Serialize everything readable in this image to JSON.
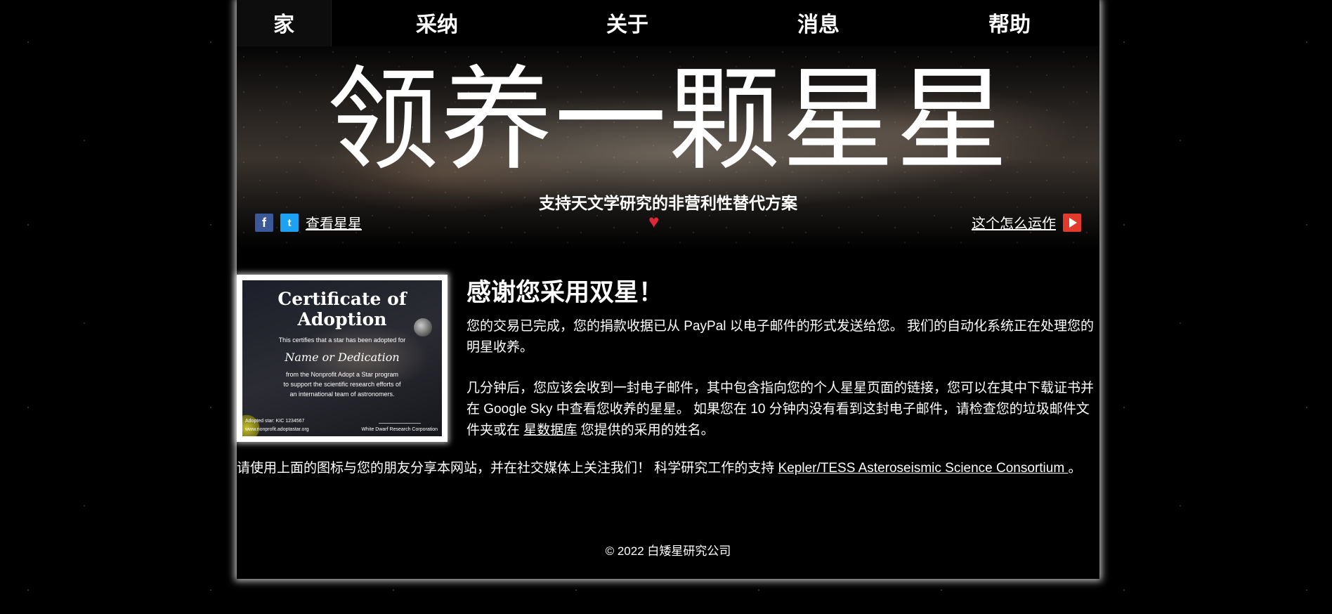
{
  "nav": {
    "home": "家",
    "adopt": "采纳",
    "about": "关于",
    "news": "消息",
    "help": "帮助"
  },
  "banner": {
    "title": "领养一颗星星",
    "subtitle": "支持天文学研究的非营利性替代方案",
    "facebook_icon_glyph": "f",
    "twitter_icon_glyph": "t",
    "view_stars_link": "查看星星",
    "heart_glyph": "♥",
    "how_it_works_link": "这个怎么运作"
  },
  "certificate": {
    "title": "Certificate of Adoption",
    "line1": "This certifies that a star has been adopted for",
    "name_line": "Name or Dedication",
    "line2": "from the Nonprofit Adopt a Star program",
    "line3": "to support the scientific research efforts of",
    "line4": "an international team of astronomers.",
    "adopted_star": "Adopted star: KIC 1234567",
    "url": "www.nonprofit.adoptastar.org",
    "company": "White Dwarf Research Corporation"
  },
  "content": {
    "heading": "感谢您采用双星！",
    "para1": "您的交易已完成，您的捐款收据已从 PayPal 以电子邮件的形式发送给您。 我们的自动化系统正在处理您的明星收养。",
    "para2_before": "几分钟后，您应该会收到一封电子邮件，其中包含指向您的个人星星页面的链接，您可以在其中下载证书并在 Google Sky 中查看您收养的星星。 如果您在 10 分钟内没有看到这封电子邮件，请检查您的垃圾邮件文件夹或在 ",
    "para2_link": "星数据库",
    "para2_after": " 您提供的采用的姓名。",
    "share_before": "请使用上面的图标与您的朋友分享本网站，并在社交媒体上关注我们！ 科学研究工作的支持 ",
    "share_link": "Kepler/TESS Asteroseismic Science Consortium ",
    "share_after": "。"
  },
  "footer": {
    "copyright": "© 2022 白矮星研究公司"
  },
  "colors": {
    "background": "#000000",
    "text": "#ffffff",
    "facebook": "#3b5998",
    "twitter": "#1da1f2",
    "heart": "#e0273a",
    "play": "#e23b2e"
  }
}
